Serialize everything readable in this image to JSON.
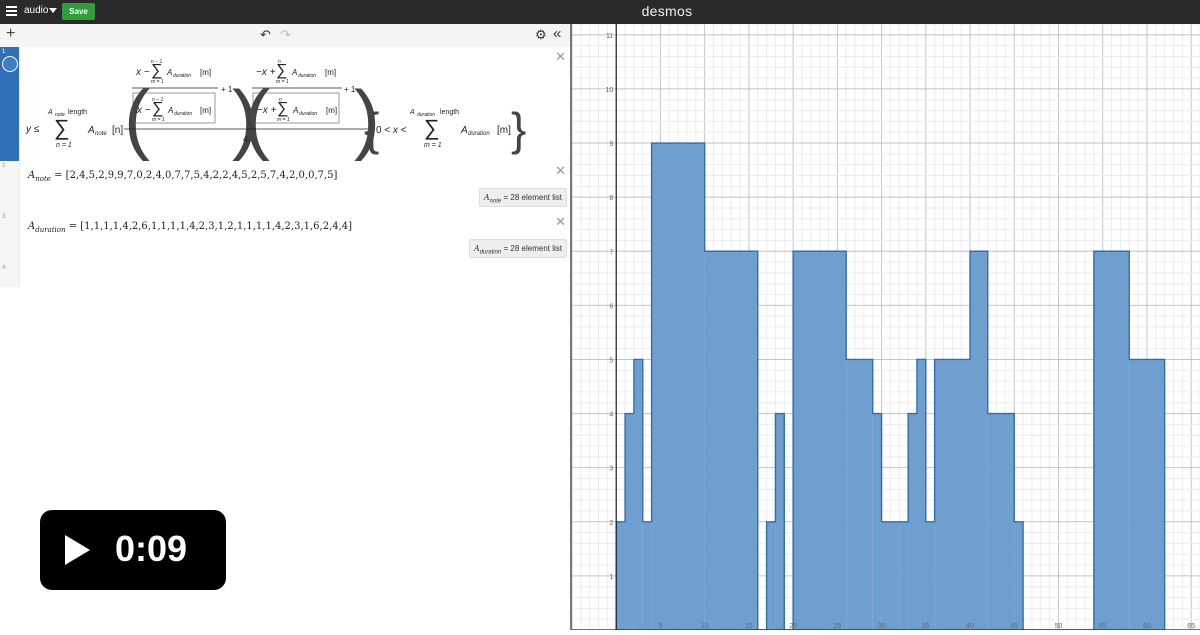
{
  "topbar": {
    "graph_title": "audio",
    "save_label": "Save",
    "logo": "desmos"
  },
  "toolbar": {
    "add": "+",
    "undo": "↶",
    "redo": "↷",
    "settings": "⚙",
    "collapse": "«"
  },
  "expressions": [
    {
      "number": "1",
      "latex": "y ≤ Σ_{n=1}^{A_note length} A_note[n] · ( (x − Σ_{m=1}^{n−1} A_duration[m]) / |x − Σ_{m=1}^{n−1} A_duration[m]| + 1 )( (−x + Σ_{m=1}^{n} A_duration[m]) / |−x + Σ_{m=1}^{n} A_duration[m]| + 1 ) / 4 {0 < x < Σ_{m=1}^{A_duration length} A_duration[m]}"
    },
    {
      "number": "2",
      "name": "A",
      "sub": "note",
      "values": "[2,4,5,2,9,9,7,0,2,4,0,7,7,5,4,2,2,4,5,2,5,7,4,2,0,0,7,5]",
      "badge_value": "28 element list"
    },
    {
      "number": "3",
      "name": "A",
      "sub": "duration",
      "values": "[1,1,1,1,4,2,6,1,1,1,1,4,2,3,1,2,1,1,1,1,4,2,3,1,6,2,4,4]",
      "badge_value": "28 element list"
    },
    {
      "number": "4"
    }
  ],
  "video": {
    "time": "0:09"
  },
  "colors": {
    "fill": "#6f9fcf",
    "stroke": "#2f6fae",
    "save": "#2f9f3b",
    "topbar": "#2a2a2a"
  },
  "chart_data": {
    "type": "area",
    "x_ticks": [
      "5",
      "10",
      "15",
      "20",
      "25",
      "30",
      "35",
      "40",
      "45",
      "50",
      "55",
      "60",
      "65"
    ],
    "y_ticks": [
      "1",
      "2",
      "3",
      "4",
      "5",
      "6",
      "7",
      "8",
      "9",
      "10",
      "11"
    ],
    "xlim": [
      -5,
      66
    ],
    "ylim": [
      0,
      11.2
    ],
    "grid": true,
    "note": [
      2,
      4,
      5,
      2,
      9,
      9,
      7,
      0,
      2,
      4,
      0,
      7,
      7,
      5,
      4,
      2,
      2,
      4,
      5,
      2,
      5,
      7,
      4,
      2,
      0,
      0,
      7,
      5
    ],
    "duration": [
      1,
      1,
      1,
      1,
      4,
      2,
      6,
      1,
      1,
      1,
      1,
      4,
      2,
      3,
      1,
      2,
      1,
      1,
      1,
      1,
      4,
      2,
      3,
      1,
      6,
      2,
      4,
      4
    ]
  }
}
